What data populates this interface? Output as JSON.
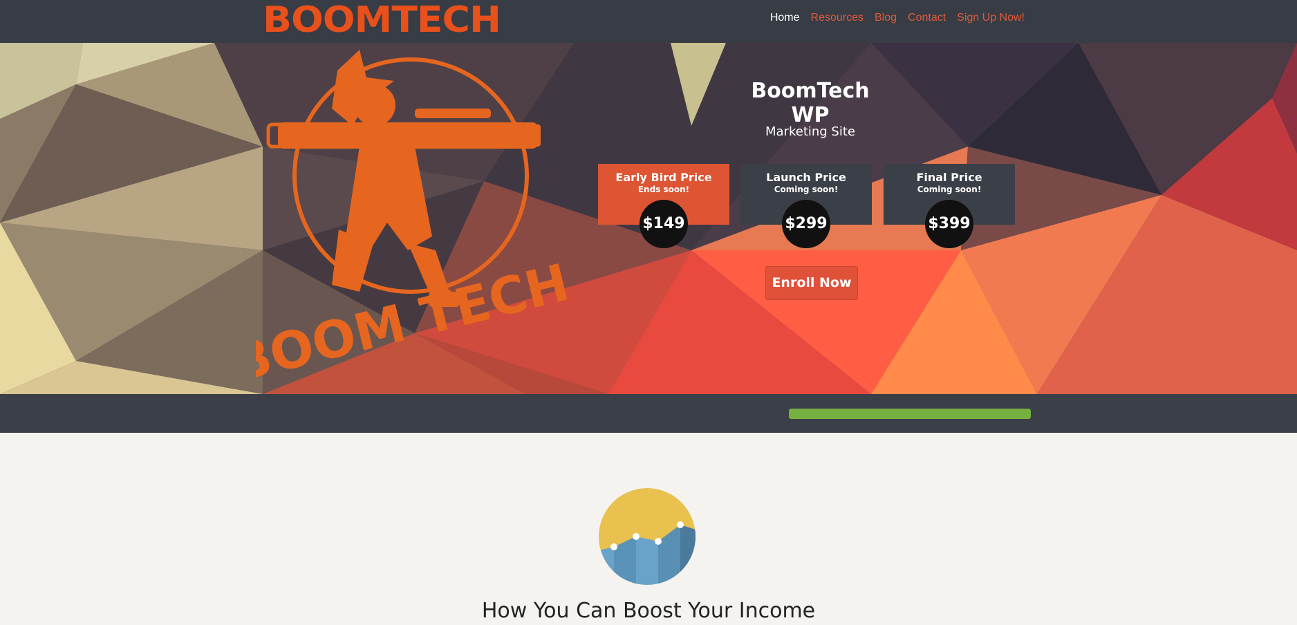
{
  "brand": {
    "name": "BOOMTECH",
    "accent": "#e8501c"
  },
  "nav": {
    "items": [
      {
        "label": "Home",
        "active": true
      },
      {
        "label": "Resources"
      },
      {
        "label": "Blog"
      },
      {
        "label": "Contact"
      },
      {
        "label": "Sign Up Now!"
      }
    ]
  },
  "hero": {
    "logo_text": "BOOM TECH",
    "title": "BoomTech WP",
    "subtitle": "Marketing Site",
    "prices": [
      {
        "name": "Early Bird Price",
        "note": "Ends soon!",
        "price": "$149",
        "color": "#dd5533"
      },
      {
        "name": "Launch Price",
        "note": "Coming soon!",
        "price": "$299",
        "color": "#3b3f47"
      },
      {
        "name": "Final Price",
        "note": "Coming soon!",
        "price": "$399",
        "color": "#3b3f47"
      }
    ],
    "cta_label": "Enroll Now"
  },
  "progress": {
    "value": 1.0,
    "color": "#76b041"
  },
  "section": {
    "icon": "growth-chart-icon",
    "title": "How You Can Boost Your Income"
  }
}
